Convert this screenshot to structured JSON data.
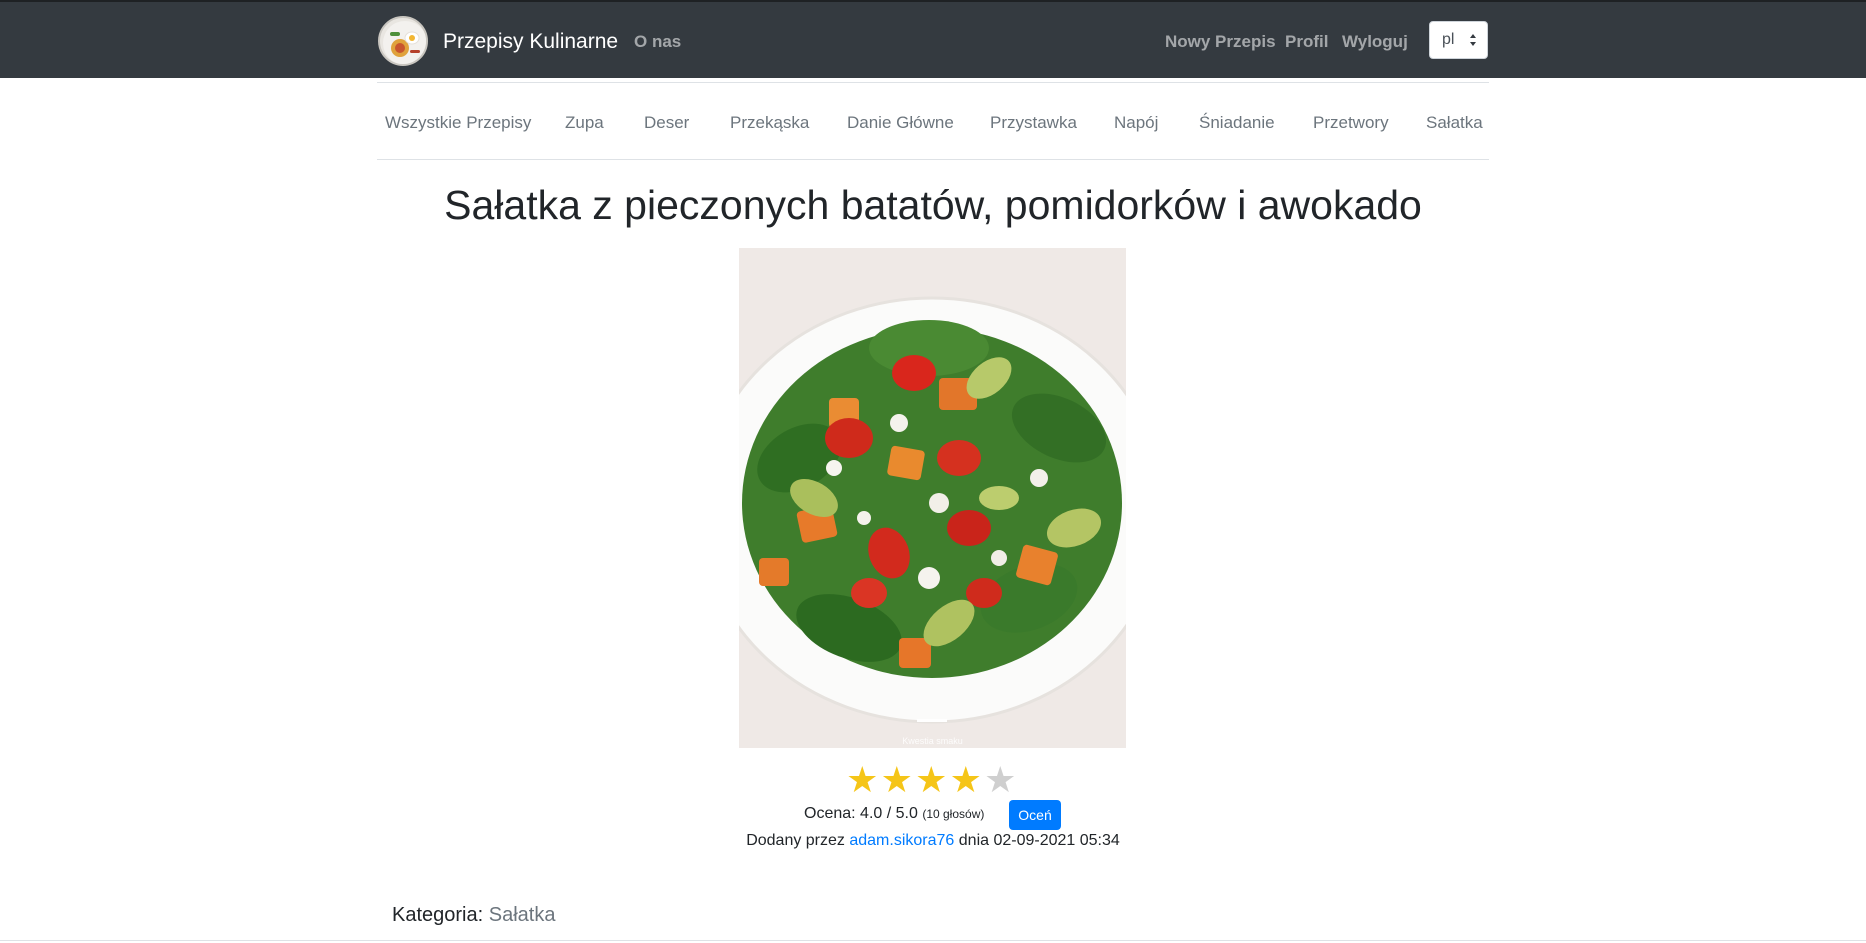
{
  "navbar": {
    "brand_name": "Przepisy Kulinarne",
    "about": "O nas",
    "new_recipe": "Nowy Przepis",
    "profile": "Profil",
    "logout": "Wyloguj",
    "language": "pl"
  },
  "categories": [
    "Wszystkie Przepisy",
    "Zupa",
    "Deser",
    "Przekąska",
    "Danie Główne",
    "Przystawka",
    "Napój",
    "Śniadanie",
    "Przetwory",
    "Sałatka"
  ],
  "recipe": {
    "title": "Sałatka z pieczonych batatów, pomidorków i awokado",
    "photo_credit": "Kwestia smaku",
    "rating": {
      "stars_filled": 4,
      "stars_total": 5,
      "label": "Ocena:",
      "value": "4.0 / 5.0",
      "votes": "(10 głosów)",
      "rate_button": "Oceń"
    },
    "added_prefix": "Dodany przez",
    "author": "adam.sikora76",
    "added_suffix": "dnia 02-09-2021 05:34",
    "category_label": "Kategoria:",
    "category_value": "Sałatka"
  },
  "colors": {
    "navbar_bg": "#343a40",
    "link": "#007bff",
    "star_on": "#f5c518",
    "star_off": "#cfcfcf"
  }
}
